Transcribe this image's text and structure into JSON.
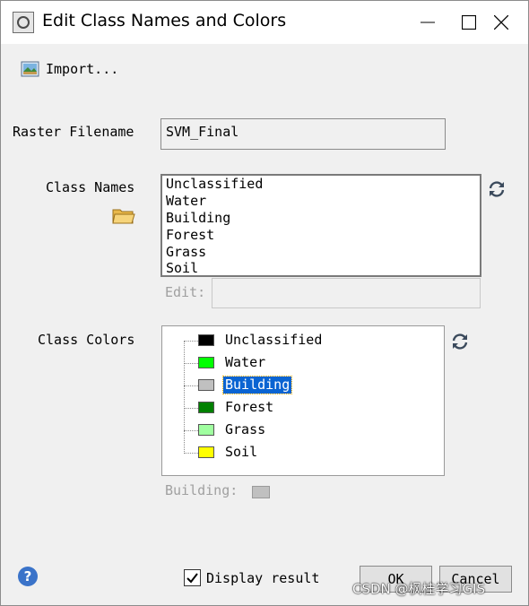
{
  "window": {
    "title": "Edit Class Names and Colors"
  },
  "toolbar": {
    "import_label": "Import..."
  },
  "raster": {
    "label": "Raster Filename",
    "value": "SVM_Final"
  },
  "class_names": {
    "label": "Class Names",
    "items": [
      "Unclassified",
      "Water",
      "Building",
      "Forest",
      "Grass",
      "Soil"
    ],
    "edit_label": "Edit:",
    "edit_value": ""
  },
  "class_colors": {
    "label": "Class Colors",
    "items": [
      {
        "name": "Unclassified",
        "color": "#000000"
      },
      {
        "name": "Water",
        "color": "#00ff00"
      },
      {
        "name": "Building",
        "color": "#c0c0c0",
        "selected": true
      },
      {
        "name": "Forest",
        "color": "#008000"
      },
      {
        "name": "Grass",
        "color": "#a0ffa0"
      },
      {
        "name": "Soil",
        "color": "#ffff00"
      }
    ],
    "selected_label": "Building:",
    "selected_color": "#c0c0c0"
  },
  "footer": {
    "display_result_label": "Display result",
    "display_result_checked": true,
    "ok_label": "OK",
    "cancel_label": "Cancel",
    "help_glyph": "?"
  },
  "watermark": "CSDN @枫桂学习GIS",
  "icons": {
    "app": "envi-app-icon",
    "import": "image-import-icon",
    "folder": "open-folder-icon",
    "refresh": "refresh-icon",
    "help": "help-icon"
  }
}
